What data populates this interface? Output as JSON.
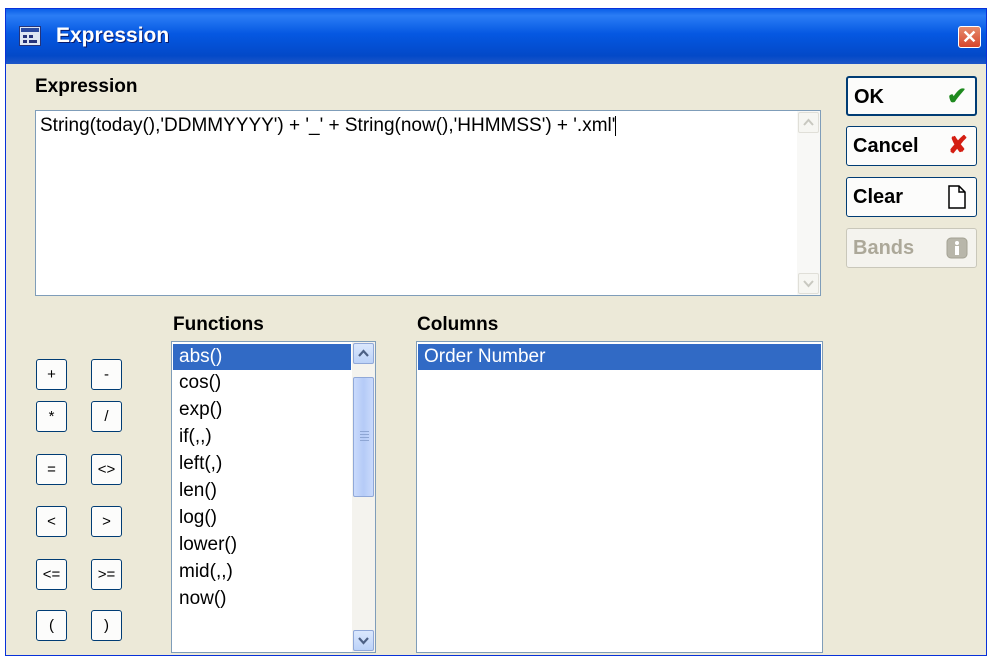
{
  "window": {
    "title": "Expression",
    "close_glyph": "✕",
    "icon": "table-icon"
  },
  "expression": {
    "label": "Expression",
    "value": "String(today(),'DDMMYYYY') + '_' + String(now(),'HHMMSS') + '.xml'"
  },
  "buttons": {
    "ok": {
      "label": "OK",
      "icon": "checkmark-icon",
      "glyph": "✔",
      "color": "#1e8a1e"
    },
    "cancel": {
      "label": "Cancel",
      "icon": "x-icon",
      "glyph": "✘",
      "color": "#d41e12"
    },
    "clear": {
      "label": "Clear",
      "icon": "blank-page-icon"
    },
    "bands": {
      "label": "Bands",
      "icon": "info-icon",
      "enabled": false
    }
  },
  "operators": [
    "+",
    "-",
    "*",
    "/",
    "=",
    "<>",
    "<",
    ">",
    "<=",
    ">=",
    "(",
    ")"
  ],
  "functions": {
    "label": "Functions",
    "items": [
      "abs()",
      "cos()",
      "exp()",
      "if(,,)",
      "left(,)",
      "len()",
      "log()",
      "lower()",
      "mid(,,)",
      "now()"
    ],
    "selected": "abs()"
  },
  "columns": {
    "label": "Columns",
    "items": [
      "Order Number"
    ],
    "selected": "Order Number"
  },
  "colors": {
    "title_bar": "#0558e2",
    "selection": "#316ac5",
    "dialog_bg": "#ece9d8"
  }
}
